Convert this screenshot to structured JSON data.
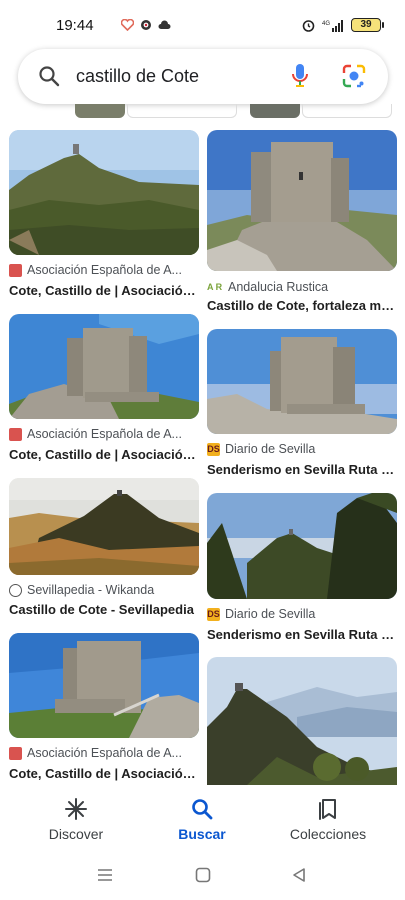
{
  "status_bar": {
    "time": "19:44",
    "battery": "39",
    "signal_text": "4G"
  },
  "search": {
    "query": "castillo de Cote"
  },
  "results": [
    {
      "source": "Asociación Española de A...",
      "title": "Cote, Castillo de | Asociación ..."
    },
    {
      "source": "Andalucia Rustica",
      "source_badge": "A R",
      "title": "Castillo de Cote, fortaleza mil..."
    },
    {
      "source": "Asociación Española de A...",
      "title": "Cote, Castillo de | Asociación ..."
    },
    {
      "source": "Diario de Sevilla",
      "source_badge": "DS",
      "title": "Senderismo en Sevilla Ruta d..."
    },
    {
      "source": "Sevillapedia - Wikanda",
      "title": "Castillo de Cote - Sevillapedia"
    },
    {
      "source": "Diario de Sevilla",
      "source_badge": "DS",
      "title": "Senderismo en Sevilla Ruta d..."
    },
    {
      "source": "Asociación Española de A...",
      "title": "Cote, Castillo de | Asociación ..."
    }
  ],
  "bottom_nav": {
    "discover": "Discover",
    "search": "Buscar",
    "collections": "Colecciones"
  },
  "colors": {
    "accent": "#0b57d0",
    "mic_blue": "#4285f4",
    "mic_red": "#ea4335"
  }
}
